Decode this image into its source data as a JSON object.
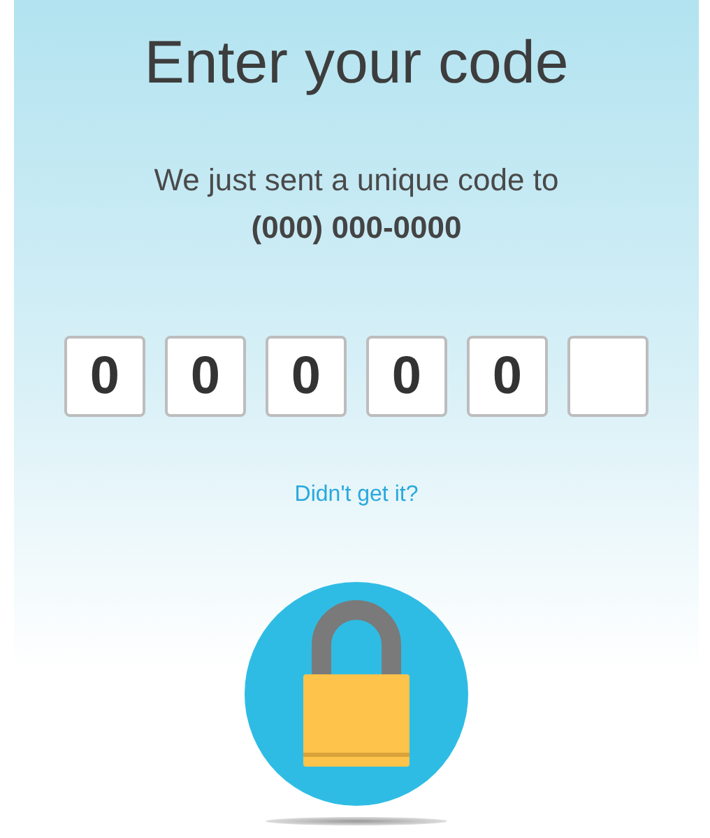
{
  "title": "Enter your code",
  "message": "We just sent a unique code to",
  "phone": "(000) 000-0000",
  "code_fields": [
    {
      "kind": "filled",
      "value": "0"
    },
    {
      "kind": "filled",
      "value": "0"
    },
    {
      "kind": "filled",
      "value": "0"
    },
    {
      "kind": "filled",
      "value": "0"
    },
    {
      "kind": "filled",
      "value": "0"
    },
    {
      "kind": "empty"
    }
  ],
  "resend_link": "Didn't get it?"
}
